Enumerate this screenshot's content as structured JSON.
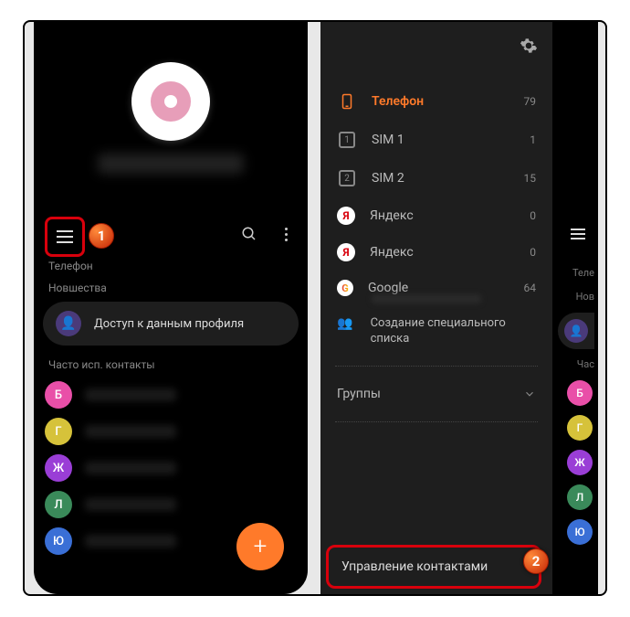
{
  "left": {
    "toolbar": {
      "section_phone": "Телефон"
    },
    "news_label": "Новшества",
    "profile_access": "Доступ к данным профиля",
    "freq_label": "Часто исп. контакты",
    "contacts": [
      {
        "letter": "Б",
        "color": "#e94fa8"
      },
      {
        "letter": "Г",
        "color": "#d6c23a"
      },
      {
        "letter": "Ж",
        "color": "#9a3ed6"
      },
      {
        "letter": "Л",
        "color": "#3a8a5a"
      },
      {
        "letter": "Ю",
        "color": "#3a6fd6"
      }
    ],
    "fab": "+"
  },
  "right": {
    "sources": [
      {
        "name": "Телефон",
        "count": "79",
        "type": "phone",
        "active": true
      },
      {
        "name": "SIM 1",
        "count": "1",
        "type": "sim"
      },
      {
        "name": "SIM 2",
        "count": "15",
        "type": "sim"
      },
      {
        "name": "Яндекс",
        "count": "0",
        "type": "yandex"
      },
      {
        "name": "Яндекс",
        "count": "0",
        "type": "yandex"
      },
      {
        "name": "Google",
        "count": "64",
        "type": "google"
      }
    ],
    "custom_list": "Создание специального списка",
    "groups": "Группы",
    "manage": "Управление контактами",
    "bg": {
      "tele": "Теле",
      "nov": "Нов",
      "chast": "Час"
    }
  },
  "badges": {
    "one": "1",
    "two": "2"
  }
}
